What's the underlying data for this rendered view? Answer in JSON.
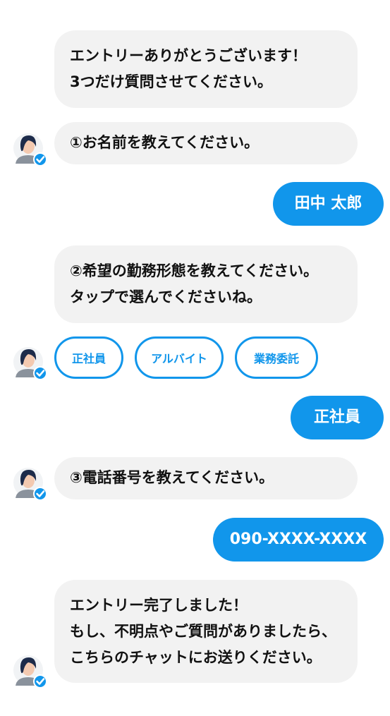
{
  "messages": {
    "m1": [
      "エントリーありがとうございます！",
      "3つだけ質問させてください。"
    ],
    "m2": [
      "①お名前を教えてください。"
    ],
    "m3": [
      "②希望の勤務形態を教えてください。",
      "タップで選んでくださいね。"
    ],
    "m4": [
      "③電話番号を教えてください。"
    ],
    "m5": [
      "エントリー完了しました！",
      "もし、不明点やご質問がありましたら、",
      "こちらのチャットにお送りください。"
    ]
  },
  "replies": {
    "name": "田中 太郎",
    "employment": "正社員",
    "phone": "090-XXXX-XXXX"
  },
  "options": [
    "正社員",
    "アルバイト",
    "業務委託"
  ],
  "colors": {
    "accent": "#1196eb",
    "bot_bubble": "#f2f2f2",
    "text": "#111111"
  }
}
